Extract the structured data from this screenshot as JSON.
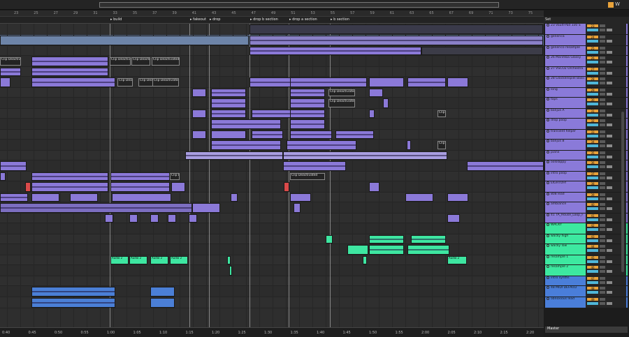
{
  "overview_ruler": {
    "numbers": [
      "23",
      "25",
      "27",
      "29",
      "31",
      "33",
      "35",
      "37",
      "39",
      "41",
      "43",
      "45",
      "47",
      "49",
      "51",
      "53",
      "55",
      "57",
      "59",
      "61",
      "63",
      "65",
      "67",
      "69",
      "71",
      "73",
      "75"
    ]
  },
  "locators": [
    "build",
    "fakeout",
    "drop",
    "drop b section",
    "drop a section",
    "b section"
  ],
  "clip_labels": {
    "deactivated": "Clip Deactivated",
    "audio2": "Audio 2"
  },
  "tracks": [
    {
      "name": "23 Vault-Pad 330 S",
      "num": "23",
      "color": "#8a7ad9"
    },
    {
      "name": "generica",
      "num": "24",
      "color": "#8a7ad9"
    },
    {
      "name": "generico resample",
      "num": "25",
      "color": "#8a7ad9"
    },
    {
      "name": "26 Marimba Glassy",
      "num": "26",
      "color": "#8a7ad9"
    },
    {
      "name": "27 VSCO2 Orchestra",
      "num": "27",
      "color": "#8a7ad9"
    },
    {
      "name": "28 Glockenspiel Basic",
      "num": "28",
      "color": "#8a7ad9"
    },
    {
      "name": "long",
      "num": "29",
      "color": "#8a7ad9"
    },
    {
      "name": "taps",
      "num": "30",
      "color": "#8a7ad9"
    },
    {
      "name": "banjus A",
      "num": "31",
      "color": "#8a7ad9"
    },
    {
      "name": "drop poop",
      "num": "32",
      "color": "#8a7ad9"
    },
    {
      "name": "transient helper",
      "num": "33",
      "color": "#8a7ad9"
    },
    {
      "name": "banjus B",
      "num": "34",
      "color": "#8a7ad9"
    },
    {
      "name": "pianx",
      "num": "35",
      "color": "#8a7ad9"
    },
    {
      "name": "oololappy",
      "num": "36",
      "color": "#8a7ad9"
    },
    {
      "name": "intro poop",
      "num": "37",
      "color": "#8a7ad9"
    },
    {
      "name": "EIGHTOH!",
      "num": "38",
      "color": "#8a7ad9"
    },
    {
      "name": "808 lead",
      "num": "39",
      "color": "#8a7ad9"
    },
    {
      "name": "ambiance",
      "num": "40",
      "color": "#8a7ad9"
    },
    {
      "name": "41 TA_House_Loop_F",
      "num": "41",
      "color": "#8a7ad9"
    },
    {
      "name": "WACKY",
      "num": "42",
      "color": "#3de8a0"
    },
    {
      "name": "wacky high",
      "num": "43",
      "color": "#3de8a0"
    },
    {
      "name": "wacky low",
      "num": "44",
      "color": "#3de8a0"
    },
    {
      "name": "resample 1",
      "num": "45",
      "color": "#3de8a0"
    },
    {
      "name": "resample 2",
      "num": "46",
      "color": "#3de8a0"
    },
    {
      "name": "intro synths",
      "num": "47",
      "color": "#4a7ed9"
    },
    {
      "name": "48 MIDI DEFAULT",
      "num": "48",
      "color": "#4a7ed9"
    },
    {
      "name": "obnoxious lead",
      "num": "49",
      "color": "#4a7ed9"
    }
  ],
  "set_label": "Set",
  "master_label": "Master",
  "time_ruler": [
    "0:40",
    "0:45",
    "0:50",
    "0:55",
    "1:00",
    "1:05",
    "1:10",
    "1:15",
    "1:20",
    "1:25",
    "1:30",
    "1:35",
    "1:40",
    "1:45",
    "1:50",
    "1:55",
    "2:00",
    "2:05",
    "2:10",
    "2:15",
    "2:20"
  ]
}
